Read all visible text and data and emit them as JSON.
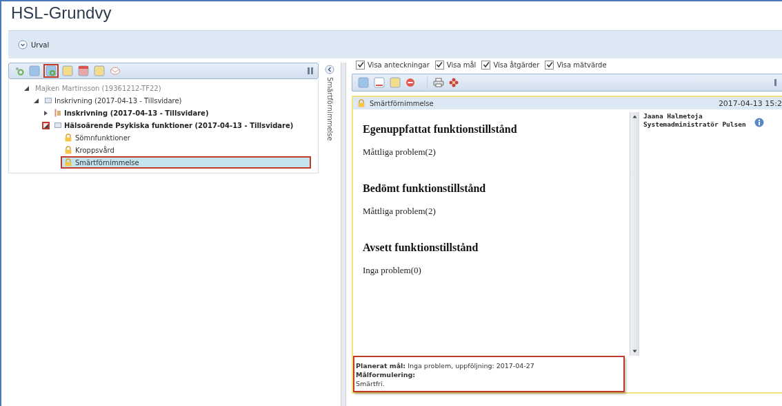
{
  "page_title": "HSL-Grundvy",
  "filter_bar": {
    "label": "Urval"
  },
  "left_toolbar": {
    "buttons": [
      {
        "kind": "add",
        "highlighted": false
      },
      {
        "kind": "doc",
        "highlighted": false
      },
      {
        "kind": "doc-add",
        "highlighted": true
      },
      {
        "kind": "note",
        "highlighted": false
      },
      {
        "kind": "calendar",
        "highlighted": false
      },
      {
        "kind": "note",
        "highlighted": false
      },
      {
        "kind": "mail",
        "highlighted": false
      }
    ]
  },
  "tree": [
    {
      "label": "Majken Martinsson (19361212-TF22)",
      "kind": "person",
      "bold": false,
      "expanded": true,
      "selected": false,
      "highlighted": false,
      "children": [
        {
          "label": "Inskrivning (2017-04-13 - Tillsvidare)",
          "kind": "folder",
          "bold": false,
          "expanded": true,
          "selected": false,
          "highlighted": false,
          "children": [
            {
              "label": "Inskrivning (2017-04-13 - Tillsvidare)",
              "kind": "case",
              "bold": true,
              "expanded": false,
              "selected": false,
              "highlighted": false
            },
            {
              "label": "Hälsoärende Psykiska funktioner (2017-04-13 - Tillsvidare)",
              "kind": "folder",
              "bold": true,
              "expanded": true,
              "selected": false,
              "highlighted": true,
              "children": [
                {
                  "label": "Sömnfunktioner",
                  "kind": "lock",
                  "bold": false,
                  "selected": false,
                  "highlighted": false
                },
                {
                  "label": "Kroppsvård",
                  "kind": "lock",
                  "bold": false,
                  "selected": false,
                  "highlighted": false
                },
                {
                  "label": "Smärtförnimmelse",
                  "kind": "lock",
                  "bold": false,
                  "selected": true,
                  "highlighted": true
                }
              ]
            }
          ]
        }
      ]
    }
  ],
  "side_label": "Smärtförnimmelse",
  "filters": [
    {
      "label": "Visa anteckningar",
      "checked": true
    },
    {
      "label": "Visa mål",
      "checked": true
    },
    {
      "label": "Visa åtgärder",
      "checked": true
    },
    {
      "label": "Visa mätvärde",
      "checked": true
    }
  ],
  "right_toolbar": {
    "buttons": [
      {
        "kind": "doc"
      },
      {
        "kind": "doc-red"
      },
      {
        "kind": "note"
      },
      {
        "kind": "stop"
      },
      {
        "kind": "print"
      },
      {
        "kind": "flower"
      }
    ]
  },
  "record": {
    "title": "Smärtförnimmelse",
    "timestamp": "2017-04-13 15:2",
    "sections": [
      {
        "heading": "Egenuppfattat funktionstillstånd",
        "value": "Måttliga problem(2)"
      },
      {
        "heading": "Bedömt funktionstillstånd",
        "value": "Måttliga problem(2)"
      },
      {
        "heading": "Avsett funktionstillstånd",
        "value": "Inga problem(0)"
      }
    ],
    "author": {
      "name": "Jaana Halmetoja",
      "role": "Systemadministratör Pulsen"
    },
    "goal": {
      "highlighted": true,
      "planned": "**Planerat mål:** Inga problem, uppföljning: 2017-04-27",
      "formulation_label": "Målformulering:",
      "formulation": "Smärtfri."
    }
  }
}
